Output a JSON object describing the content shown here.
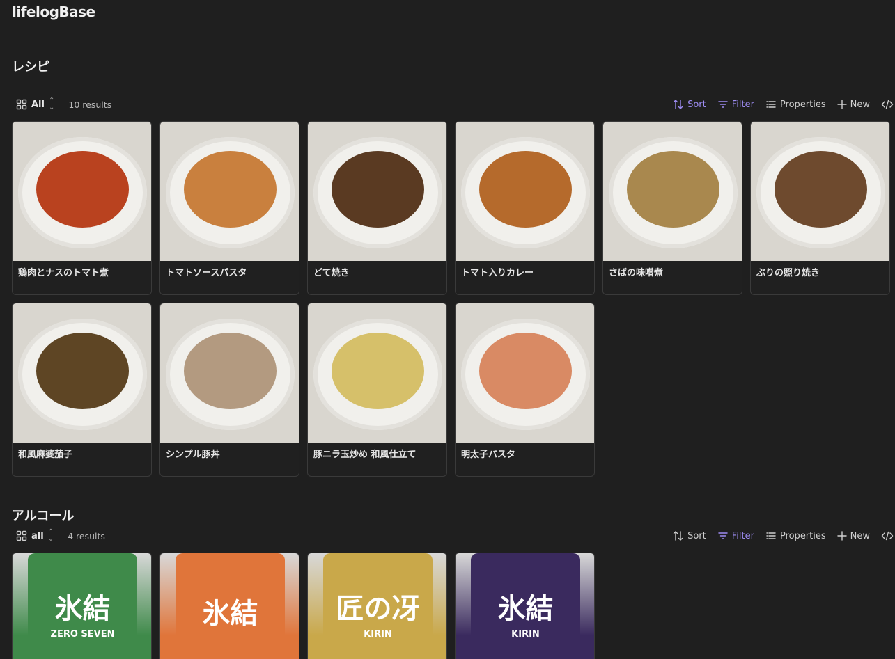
{
  "app": {
    "title": "lifelogBase"
  },
  "sections": [
    {
      "title": "レシピ",
      "view": "All",
      "results": "10 results",
      "actions": {
        "sort": "Sort",
        "filter": "Filter",
        "properties": "Properties",
        "new": "New"
      },
      "cards": [
        {
          "name": "鶏肉とナスのトマト煮",
          "color": "#b9421f"
        },
        {
          "name": "トマトソースパスタ",
          "color": "#c9803e"
        },
        {
          "name": "どて焼き",
          "color": "#5a3a22"
        },
        {
          "name": "トマト入りカレー",
          "color": "#b56a2c"
        },
        {
          "name": "さばの味噌煮",
          "color": "#a9884e"
        },
        {
          "name": "ぶりの照り焼き",
          "color": "#6e4a2e"
        },
        {
          "name": "和風麻婆茄子",
          "color": "#5e4524"
        },
        {
          "name": "シンプル豚丼",
          "color": "#b39a80"
        },
        {
          "name": "豚ニラ玉炒め 和風仕立て",
          "color": "#d6c06a"
        },
        {
          "name": "明太子パスタ",
          "color": "#d98a64"
        }
      ]
    },
    {
      "title": "アルコール",
      "view": "all",
      "results": "4 results",
      "actions": {
        "sort": "Sort",
        "filter": "Filter",
        "properties": "Properties",
        "new": "New"
      },
      "cards": [
        {
          "label": "氷結",
          "sublabel": "ZERO SEVEN",
          "color": "#3f8a4a"
        },
        {
          "label": "氷結",
          "sublabel": "",
          "color": "#e0753a"
        },
        {
          "label": "匠の冴",
          "sublabel": "KIRIN",
          "color": "#c9a84a"
        },
        {
          "label": "氷結",
          "sublabel": "KIRIN",
          "color": "#3a2a5e"
        }
      ]
    }
  ]
}
